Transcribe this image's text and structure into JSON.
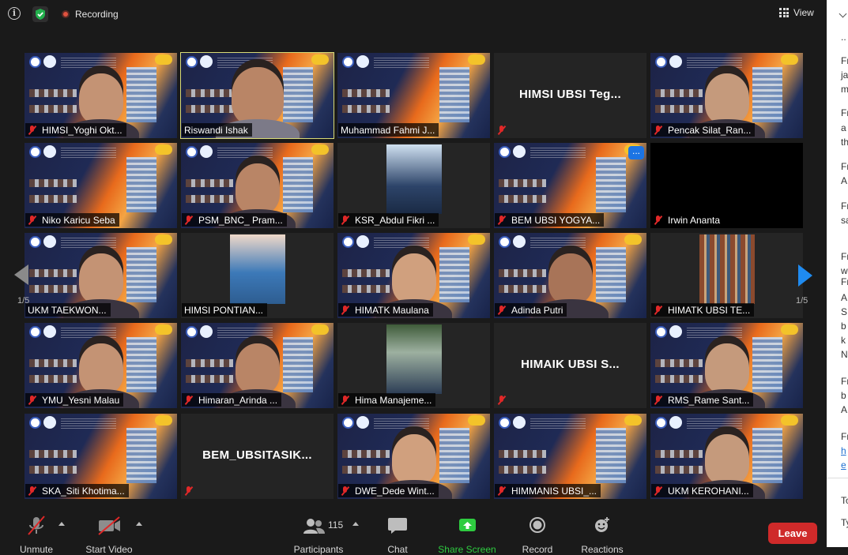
{
  "topbar": {
    "recording_label": "Recording",
    "view_label": "View",
    "icons": [
      "info-icon",
      "shield-check-icon",
      "record-dot-icon",
      "grid-view-icon"
    ]
  },
  "gallery": {
    "page_indicator_left": "1/5",
    "page_indicator_right": "1/5",
    "tiles": [
      {
        "name": "HIMSI_Yoghi Okt...",
        "muted": true,
        "kind": "poster"
      },
      {
        "name": "Riswandi Ishak",
        "muted": false,
        "kind": "poster",
        "active": true
      },
      {
        "name": "Muhammad Fahmi J...",
        "muted": false,
        "kind": "poster"
      },
      {
        "name": "",
        "muted": true,
        "kind": "text",
        "center_text": "HIMSI UBSI Teg..."
      },
      {
        "name": "Pencak Silat_Ran...",
        "muted": true,
        "kind": "poster"
      },
      {
        "name": "Niko Karicu Seba",
        "muted": true,
        "kind": "poster"
      },
      {
        "name": "PSM_BNC_ Pram...",
        "muted": true,
        "kind": "poster"
      },
      {
        "name": "KSR_Abdul Fikri ...",
        "muted": true,
        "kind": "photo"
      },
      {
        "name": "BEM UBSI YOGYA...",
        "muted": true,
        "kind": "poster",
        "more_button": "..."
      },
      {
        "name": "Irwin Ananta",
        "muted": true,
        "kind": "black"
      },
      {
        "name": "UKM TAEKWON...",
        "muted": false,
        "kind": "poster"
      },
      {
        "name": "HIMSI PONTIAN...",
        "muted": false,
        "kind": "photo"
      },
      {
        "name": "HIMATK Maulana",
        "muted": true,
        "kind": "poster"
      },
      {
        "name": "Adinda Putri",
        "muted": true,
        "kind": "poster"
      },
      {
        "name": "HIMATK UBSI TE...",
        "muted": true,
        "kind": "photo"
      },
      {
        "name": "YMU_Yesni Malau",
        "muted": true,
        "kind": "poster"
      },
      {
        "name": "Himaran_Arinda ...",
        "muted": true,
        "kind": "poster"
      },
      {
        "name": "Hima Manajeme...",
        "muted": true,
        "kind": "photo"
      },
      {
        "name": "",
        "muted": true,
        "kind": "text",
        "center_text": "HIMAIK UBSI S..."
      },
      {
        "name": "RMS_Rame Sant...",
        "muted": true,
        "kind": "poster"
      },
      {
        "name": "SKA_Siti Khotima...",
        "muted": true,
        "kind": "poster"
      },
      {
        "name": "",
        "muted": true,
        "kind": "text",
        "center_text": "BEM_UBSITASIK..."
      },
      {
        "name": "DWE_Dede Wint...",
        "muted": true,
        "kind": "poster"
      },
      {
        "name": "HIMMANIS UBSI_...",
        "muted": true,
        "kind": "poster"
      },
      {
        "name": "UKM KEROHANI...",
        "muted": true,
        "kind": "poster"
      }
    ]
  },
  "toolbar": {
    "unmute_label": "Unmute",
    "start_video_label": "Start Video",
    "participants_label": "Participants",
    "participants_count": "115",
    "chat_label": "Chat",
    "share_screen_label": "Share Screen",
    "record_label": "Record",
    "reactions_label": "Reactions",
    "leave_label": "Leave"
  },
  "chat_panel": {
    "lines": [
      "..",
      "Fr",
      "ja",
      "m",
      "Fr",
      "a",
      "th",
      "Fr",
      "A",
      "Fr",
      "sa",
      "Fr",
      "w",
      "Fr",
      "A",
      "S",
      "b",
      "k",
      "N",
      "Fr",
      "b",
      "A",
      "Fr",
      "h",
      "e",
      "To",
      "Ty"
    ]
  },
  "colors": {
    "background": "#1a1a1a",
    "active_speaker_border": "#d9db76",
    "muted_red": "#e02828",
    "share_green": "#2ecc40",
    "leave_red": "#cf2a2a",
    "nav_blue": "#1f8bf0"
  }
}
